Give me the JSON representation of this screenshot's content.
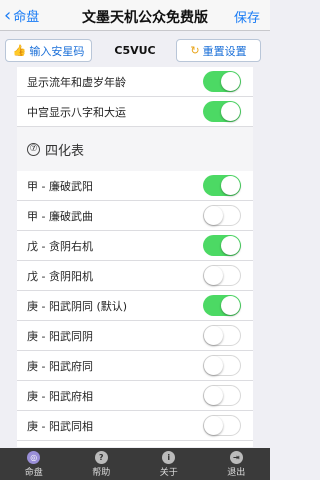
{
  "nav": {
    "back_label": "命盘",
    "title": "文墨天机公众免费版",
    "save_label": "保存"
  },
  "toolbar": {
    "input_label": "输入安星码",
    "code": "C5VUC",
    "reset_label": "重置设置"
  },
  "top_rows": [
    {
      "label": "显示流年和虚岁年龄",
      "on": true
    },
    {
      "label": "中宫显示八字和大运",
      "on": true
    }
  ],
  "section": {
    "number": "⑦",
    "title": "四化表"
  },
  "rows": [
    {
      "label": "甲 - 廉破武阳",
      "on": true
    },
    {
      "label": "甲 - 廉破武曲",
      "on": false
    },
    {
      "label": "戊 - 贪阴右机",
      "on": true
    },
    {
      "label": "戊 - 贪阴阳机",
      "on": false
    },
    {
      "label": "庚 - 阳武阴同 (默认)",
      "on": true
    },
    {
      "label": "庚 - 阳武同阴",
      "on": false
    },
    {
      "label": "庚 - 阳武府同",
      "on": false
    },
    {
      "label": "庚 - 阳武府相",
      "on": false
    },
    {
      "label": "庚 - 阳武同相",
      "on": false
    }
  ],
  "tabs": [
    {
      "label": "命盘",
      "icon": "chart-icon",
      "glyph": "◎"
    },
    {
      "label": "帮助",
      "icon": "help-icon",
      "glyph": "?"
    },
    {
      "label": "关于",
      "icon": "info-icon",
      "glyph": "i"
    },
    {
      "label": "退出",
      "icon": "exit-icon",
      "glyph": "⇥"
    }
  ],
  "colors": {
    "accent": "#1a7cf5",
    "switch_on": "#4cd964",
    "tabbar": "#3a3a3a"
  }
}
